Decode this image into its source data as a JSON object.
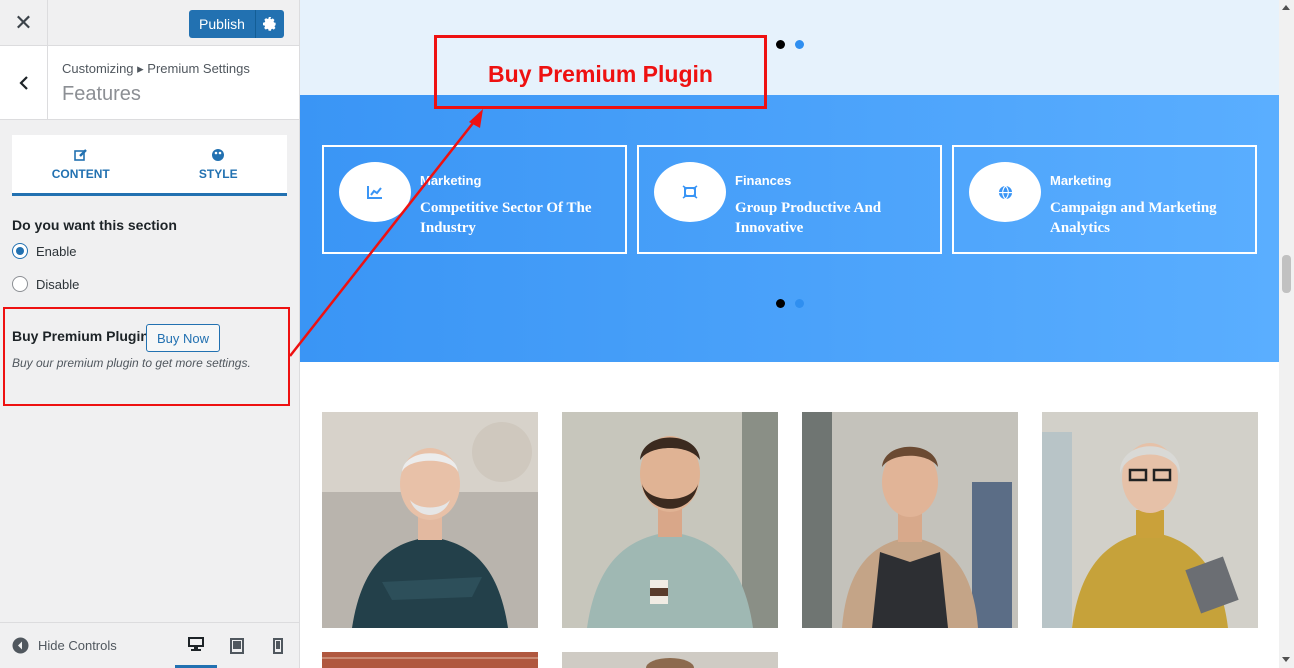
{
  "topbar": {
    "close_glyph": "✕",
    "publish_label": "Publish",
    "settings_icon": "gear-icon"
  },
  "section": {
    "breadcrumb": "Customizing ▸ Premium Settings",
    "title": "Features"
  },
  "tabs": [
    {
      "label": "CONTENT",
      "icon": "edit-icon"
    },
    {
      "label": "STYLE",
      "icon": "palette-icon"
    }
  ],
  "section_toggle": {
    "question": "Do you want this section",
    "options": [
      "Enable",
      "Disable"
    ],
    "selected": "Enable"
  },
  "premium": {
    "title": "Buy Premium Plugin",
    "button": "Buy Now",
    "description": "Buy our premium plugin to get more settings."
  },
  "footer": {
    "hide_controls": "Hide Controls",
    "devices": [
      "desktop",
      "tablet",
      "mobile"
    ],
    "active_device": "desktop"
  },
  "preview": {
    "callout": "Buy Premium Plugin",
    "features": [
      {
        "category": "Marketing",
        "title": "Competitive Sector Of The Industry",
        "icon": "chart-icon"
      },
      {
        "category": "Finances",
        "title": "Group Productive And Innovative",
        "icon": "frame-icon"
      },
      {
        "category": "Marketing",
        "title": "Campaign and Marketing Analytics",
        "icon": "globe-icon"
      }
    ],
    "team_photos": [
      "older man crossed arms",
      "bearded man with coffee",
      "man in vest",
      "woman in yellow sweater"
    ]
  },
  "colors": {
    "accent": "#2271b1",
    "highlight": "#ee1111",
    "feature_bg": "#3a95f5",
    "hero_bg": "#e6f2fc"
  }
}
